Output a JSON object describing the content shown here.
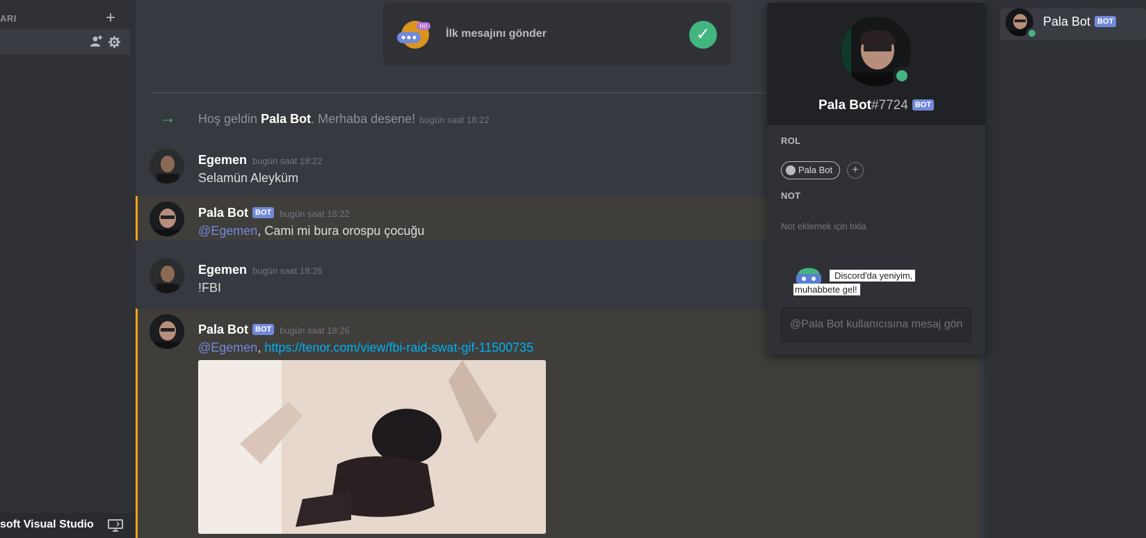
{
  "sidebar": {
    "header_title": "ARI",
    "add_channel_icon": "plus-icon",
    "bottom_label": "soft Visual Studio"
  },
  "onboarding": {
    "first_message": "İlk mesajını gönder",
    "badge": "Hi!"
  },
  "welcome": {
    "prefix": "Hoş geldin ",
    "name": "Pala Bot",
    "suffix": ". Merhaba desene!",
    "time": "bugün saat 18:22"
  },
  "messages": [
    {
      "author": "Egemen",
      "time": "bugün saat 18:22",
      "text": "Selamün Aleyküm",
      "bot": false
    },
    {
      "author": "Pala Bot",
      "tag": "BOT",
      "time": "bugün saat 18:22",
      "mention": "@Egemen",
      "text": ", Cami mi bura orospu çocuğu",
      "bot": true
    },
    {
      "author": "Egemen",
      "time": "bugün saat 18:26",
      "text": "!FBI",
      "bot": false
    },
    {
      "author": "Pala Bot",
      "tag": "BOT",
      "time": "bugün saat 18:26",
      "mention": "@Egemen",
      "separator": ", ",
      "link": "https://tenor.com/view/fbi-raid-swat-gif-11500735",
      "bot": true
    }
  ],
  "popout": {
    "username": "Pala Bot",
    "discriminator": "#7724",
    "tag": "BOT",
    "role_label": "ROL",
    "role_name": "Pala Bot",
    "role_add": "+",
    "note_label": "NOT",
    "note_placeholder": "Not eklemek için tıkla",
    "tip_line1": "Discord'da yeniyim,",
    "tip_line2": "muhabbete gel!",
    "dm_placeholder": "@Pala Bot kullanıcısına mesaj gön"
  },
  "members": [
    {
      "name": "Pala Bot",
      "tag": "BOT",
      "status": "online"
    }
  ],
  "colors": {
    "accent": "#7289da",
    "online": "#43b581",
    "mention_bar": "#faa61a",
    "link": "#00b0f4"
  }
}
